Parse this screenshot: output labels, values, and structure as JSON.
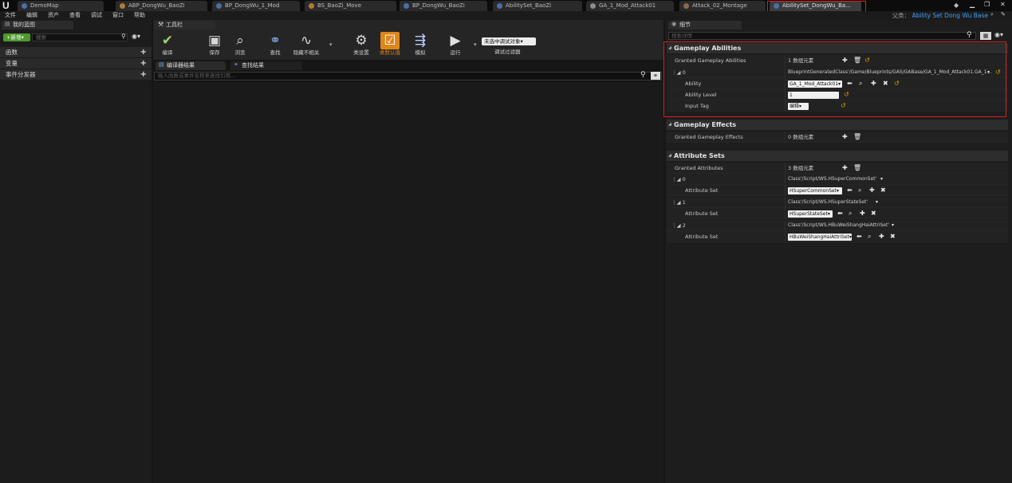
{
  "tabs": [
    "DemoMap",
    "ABP_DongWu_BaoZi",
    "BP_DongWu_1_Mod",
    "BS_BaoZi_Move",
    "BP_DongWu_BaoZi",
    "AbilitySet_BaoZi",
    "GA_1_Mod_Attack01",
    "Attack_02_Montage",
    "AbilitySet_DongWu_Ba..."
  ],
  "menu": [
    "文件",
    "编辑",
    "资产",
    "查看",
    "调试",
    "窗口",
    "帮助"
  ],
  "parent_class": {
    "label": "父类：",
    "value": "Ability Set Dong Wu Base"
  },
  "left": {
    "header": "我的蓝图",
    "new_label": "+新增▾",
    "search_placeholder": "搜索",
    "rows": [
      "函数",
      "变量",
      "事件分发器"
    ]
  },
  "toolbar": {
    "header": "工具栏",
    "buttons": [
      "编译",
      "保存",
      "浏览",
      "查找",
      "隐藏不相关",
      "类设置",
      "类默认值",
      "模拟",
      "运行"
    ],
    "debug_select": "未选中调试对象▾",
    "debug_filter": "调试过滤器"
  },
  "results": {
    "tab1": "编译器结果",
    "tab2": "查找结果",
    "search_placeholder": "输入函数或事件名称来查找引用..."
  },
  "details": {
    "header": "细节",
    "search_placeholder": "搜索详情",
    "cat_abilities": "Gameplay Abilities",
    "granted_abilities": "Granted Gameplay Abilities",
    "granted_abilities_count": "1 数组元素",
    "ab_index": "0",
    "ab_class_path": "BlueprintGeneratedClass'/Game/Blueprints/GAS/GABase/GA_1_Mod_Attack01.GA_1...",
    "ability_label": "Ability",
    "ability_value": "GA_1_Mod_Attack01▾",
    "level_label": "Ability Level",
    "level_value": "1",
    "input_tag_label": "Input Tag",
    "input_tag_value": "编辑▾",
    "cat_effects": "Gameplay Effects",
    "granted_effects": "Granted Gameplay Effects",
    "granted_effects_count": "0 数组元素",
    "cat_attributes": "Attribute Sets",
    "granted_attributes": "Granted Attributes",
    "granted_attributes_count": "3 数组元素",
    "attr_set_label": "Attribute Set",
    "attrs": [
      {
        "index": "0",
        "path": "Class'/Script/WS.HSuperCommonSet'",
        "value": "HSuperCommonSet▾"
      },
      {
        "index": "1",
        "path": "Class'/Script/WS.HSuperStateSet'",
        "value": "HSuperStateSet▾"
      },
      {
        "index": "2",
        "path": "Class'/Script/WS.HBuWeiShangHaiAttriSet'",
        "value": "HBuWeiShangHaiAttriSet▾"
      }
    ]
  },
  "colors": {
    "accent": "#e0851a",
    "highlight": "#d92020",
    "new_button": "#4d9a2a",
    "link": "#3aa0ff"
  }
}
